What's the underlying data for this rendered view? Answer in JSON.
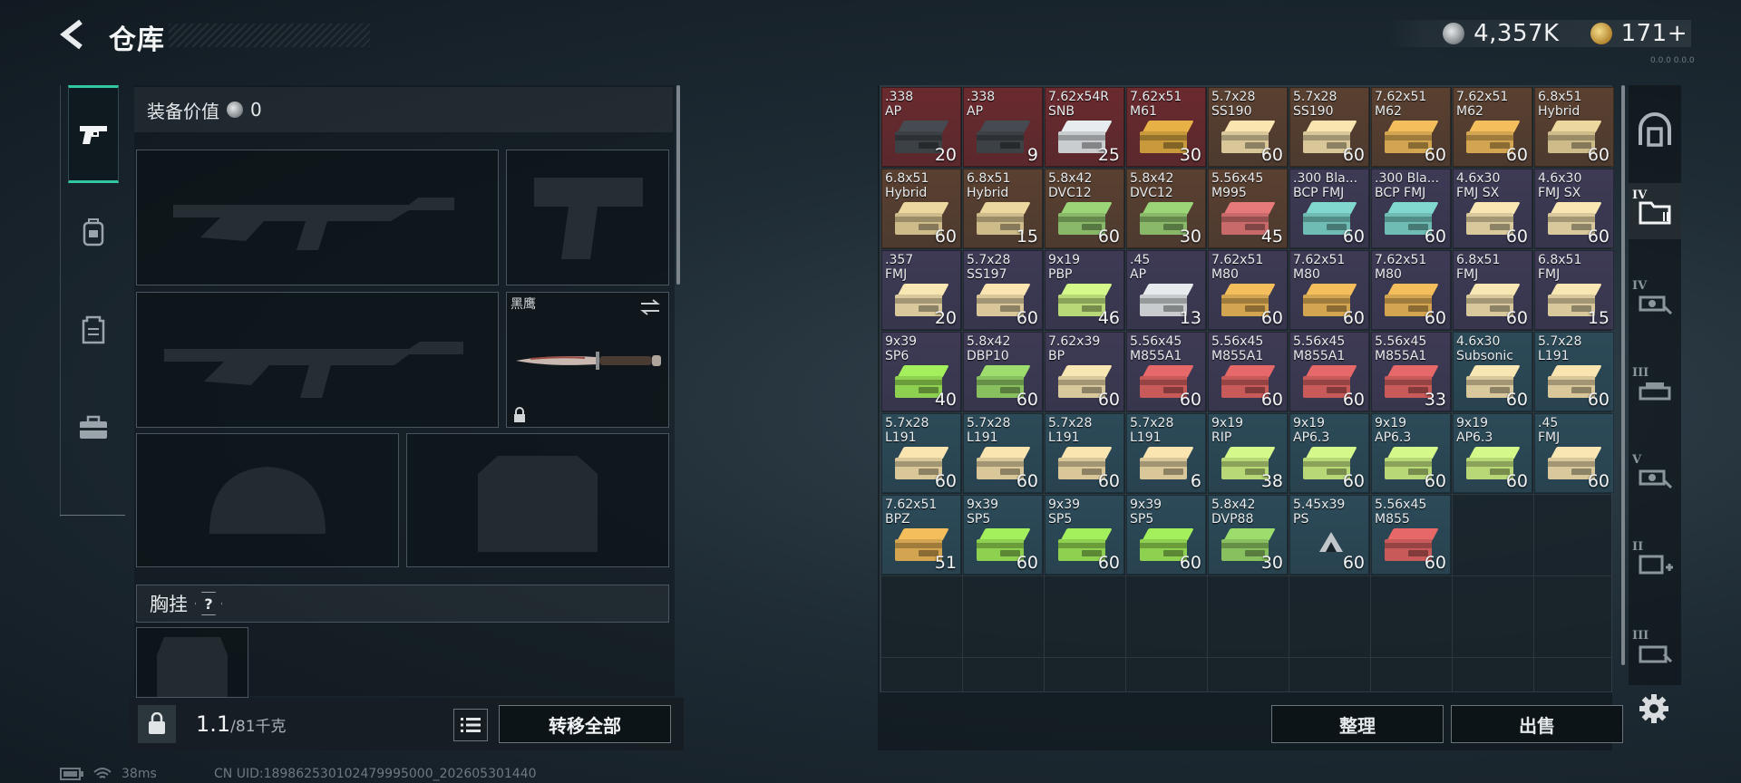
{
  "header": {
    "title": "仓库",
    "silver_amount": "4,357K",
    "gold_amount": "171+",
    "version": "0.0.0 0.0.0"
  },
  "equipment": {
    "value_label": "装备价值",
    "value": "0",
    "knife_name": "黑鹰",
    "rig_label": "胸挂",
    "help": "?"
  },
  "footer": {
    "weight": "1.1",
    "weight_max": "/81千克",
    "transfer_all": "转移全部",
    "sort": "整理",
    "sell": "出售",
    "ping": "38ms",
    "uid": "CN UID:1898625301024799950​00_202605301440"
  },
  "right_tiers": [
    "IV",
    "IV",
    "III",
    "V",
    "II",
    "III"
  ],
  "stash": {
    "items": [
      {
        "label": ".338\nAP",
        "count": "20",
        "bg": "#6a2a2e",
        "box": "#3c4146"
      },
      {
        "label": ".338\nAP",
        "count": "9",
        "bg": "#6a2a2e",
        "box": "#3c4146"
      },
      {
        "label": "7.62x54R\nSNB",
        "count": "25",
        "bg": "#6a2a2e",
        "box": "#c9cdd0"
      },
      {
        "label": "7.62x51\nM61",
        "count": "30",
        "bg": "#6a2a2e",
        "box": "#c99a3c"
      },
      {
        "label": "5.7x28\nSS190",
        "count": "60",
        "bg": "#5a4030",
        "box": "#d9c79a"
      },
      {
        "label": "5.7x28\nSS190",
        "count": "60",
        "bg": "#5a4030",
        "box": "#d9c79a"
      },
      {
        "label": "7.62x51\nM62",
        "count": "60",
        "bg": "#5a4030",
        "box": "#d4a550"
      },
      {
        "label": "7.62x51\nM62",
        "count": "60",
        "bg": "#5a4030",
        "box": "#d4a550"
      },
      {
        "label": "6.8x51\nHybrid",
        "count": "60",
        "bg": "#5a4030",
        "box": "#cdbb8a"
      },
      {
        "label": "6.8x51\nHybrid",
        "count": "60",
        "bg": "#5a4030",
        "box": "#cdbb8a"
      },
      {
        "label": "6.8x51\nHybrid",
        "count": "15",
        "bg": "#5a4030",
        "box": "#cdbb8a"
      },
      {
        "label": "5.8x42\nDVC12",
        "count": "60",
        "bg": "#5a4030",
        "box": "#88b868"
      },
      {
        "label": "5.8x42\nDVC12",
        "count": "30",
        "bg": "#5a4030",
        "box": "#88b868"
      },
      {
        "label": "5.56x45\nM995",
        "count": "45",
        "bg": "#5a4030",
        "box": "#c86a6a"
      },
      {
        "label": ".300 Bla...\nBCP FMJ",
        "count": "60",
        "bg": "#3e3a55",
        "box": "#6fbcb4"
      },
      {
        "label": ".300 Bla...\nBCP FMJ",
        "count": "60",
        "bg": "#3e3a55",
        "box": "#6fbcb4"
      },
      {
        "label": "4.6x30\nFMJ SX",
        "count": "60",
        "bg": "#3e3a55",
        "box": "#d8c89c"
      },
      {
        "label": "4.6x30\nFMJ SX",
        "count": "60",
        "bg": "#3e3a55",
        "box": "#d8c89c"
      },
      {
        "label": ".357\nFMJ",
        "count": "20",
        "bg": "#3e3a55",
        "box": "#d8c89c"
      },
      {
        "label": "5.7x28\nSS197",
        "count": "60",
        "bg": "#3e3a55",
        "box": "#d9c79a"
      },
      {
        "label": "9x19\nPBP",
        "count": "46",
        "bg": "#3e3a55",
        "box": "#b8d878"
      },
      {
        "label": ".45\nAP",
        "count": "13",
        "bg": "#3e3a55",
        "box": "#c8ccce"
      },
      {
        "label": "7.62x51\nM80",
        "count": "60",
        "bg": "#3e3a55",
        "box": "#d4a550"
      },
      {
        "label": "7.62x51\nM80",
        "count": "60",
        "bg": "#3e3a55",
        "box": "#d4a550"
      },
      {
        "label": "7.62x51\nM80",
        "count": "60",
        "bg": "#3e3a55",
        "box": "#d4a550"
      },
      {
        "label": "6.8x51\nFMJ",
        "count": "60",
        "bg": "#3e3a55",
        "box": "#d8c89c"
      },
      {
        "label": "6.8x51\nFMJ",
        "count": "15",
        "bg": "#3e3a55",
        "box": "#d8c89c"
      },
      {
        "label": "9x39\nSP6",
        "count": "40",
        "bg": "#3e3a55",
        "box": "#8ed050"
      },
      {
        "label": "5.8x42\nDBP10",
        "count": "60",
        "bg": "#3e3a55",
        "box": "#88c060"
      },
      {
        "label": "7.62x39\nBP",
        "count": "60",
        "bg": "#3e3a55",
        "box": "#d8c89c"
      },
      {
        "label": "5.56x45\nM855A1",
        "count": "60",
        "bg": "#3e3a55",
        "box": "#c85a5a"
      },
      {
        "label": "5.56x45\nM855A1",
        "count": "60",
        "bg": "#3e3a55",
        "box": "#c85a5a"
      },
      {
        "label": "5.56x45\nM855A1",
        "count": "60",
        "bg": "#3e3a55",
        "box": "#c85a5a"
      },
      {
        "label": "5.56x45\nM855A1",
        "count": "33",
        "bg": "#3e3a55",
        "box": "#c85a5a"
      },
      {
        "label": "4.6x30\nSubsonic",
        "count": "60",
        "bg": "#2c4a58",
        "box": "#d8c89c"
      },
      {
        "label": "5.7x28\nL191",
        "count": "60",
        "bg": "#2c4a58",
        "box": "#d9c79a"
      },
      {
        "label": "5.7x28\nL191",
        "count": "60",
        "bg": "#2c4a58",
        "box": "#d9c79a"
      },
      {
        "label": "5.7x28\nL191",
        "count": "60",
        "bg": "#2c4a58",
        "box": "#d9c79a"
      },
      {
        "label": "5.7x28\nL191",
        "count": "60",
        "bg": "#2c4a58",
        "box": "#d9c79a"
      },
      {
        "label": "5.7x28\nL191",
        "count": "6",
        "bg": "#2c4a58",
        "box": "#d9c79a"
      },
      {
        "label": "9x19\nRIP",
        "count": "38",
        "bg": "#2c4a58",
        "box": "#b8d878"
      },
      {
        "label": "9x19\nAP6.3",
        "count": "60",
        "bg": "#2c4a58",
        "box": "#b8d878"
      },
      {
        "label": "9x19\nAP6.3",
        "count": "60",
        "bg": "#2c4a58",
        "box": "#b8d878"
      },
      {
        "label": "9x19\nAP6.3",
        "count": "60",
        "bg": "#2c4a58",
        "box": "#b8d878"
      },
      {
        "label": ".45\nFMJ",
        "count": "60",
        "bg": "#2c4a58",
        "box": "#d8c89c"
      },
      {
        "label": "7.62x51\nBPZ",
        "count": "51",
        "bg": "#2c4a58",
        "box": "#d4a550"
      },
      {
        "label": "9x39\nSP5",
        "count": "60",
        "bg": "#2c4a58",
        "box": "#8ed050"
      },
      {
        "label": "9x39\nSP5",
        "count": "60",
        "bg": "#2c4a58",
        "box": "#8ed050"
      },
      {
        "label": "9x39\nSP5",
        "count": "60",
        "bg": "#2c4a58",
        "box": "#8ed050"
      },
      {
        "label": "5.8x42\nDVP88",
        "count": "30",
        "bg": "#2c4a58",
        "box": "#88c060"
      },
      {
        "label": "5.45x39\nPS",
        "count": "60",
        "bg": "#2c4a58",
        "box": "none"
      },
      {
        "label": "5.56x45\nM855",
        "count": "60",
        "bg": "#2c4a58",
        "box": "#c85a5a"
      }
    ]
  }
}
